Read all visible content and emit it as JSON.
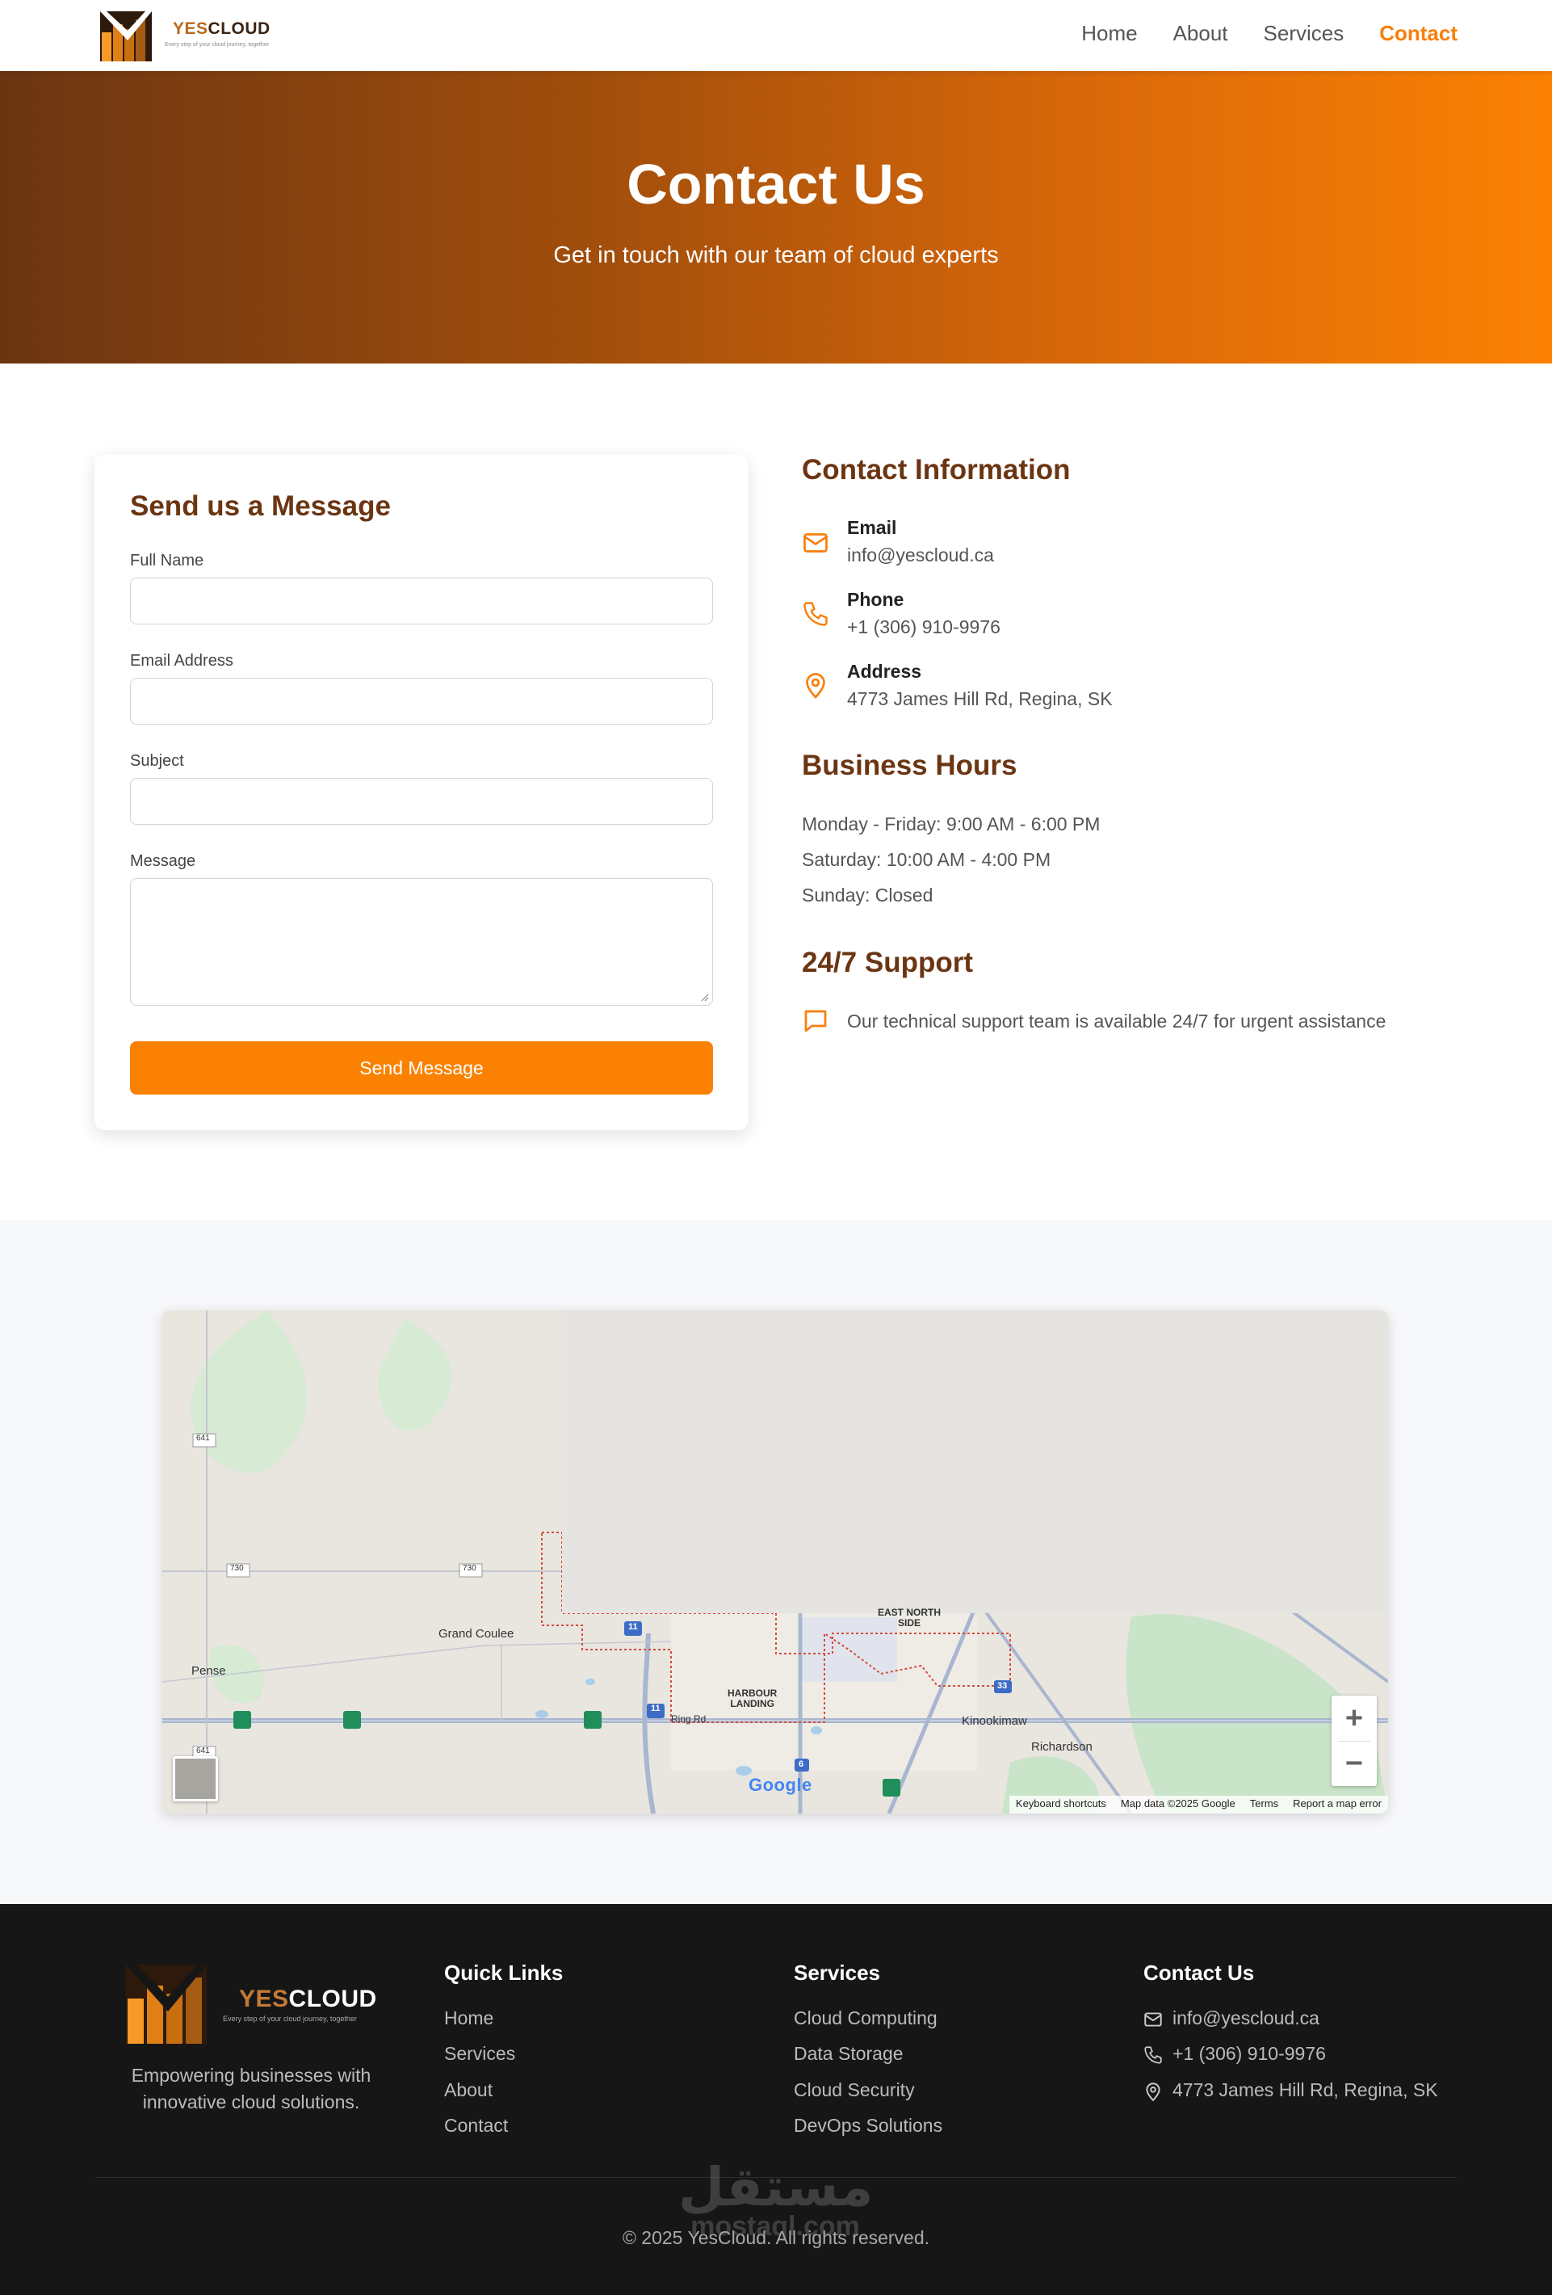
{
  "brand": {
    "name_part1": "YES",
    "name_part2": "CLOUD",
    "tagline": "Every step of your cloud journey, together"
  },
  "nav": {
    "links": [
      {
        "label": "Home",
        "active": false
      },
      {
        "label": "About",
        "active": false
      },
      {
        "label": "Services",
        "active": false
      },
      {
        "label": "Contact",
        "active": true
      }
    ]
  },
  "hero": {
    "title": "Contact Us",
    "subtitle": "Get in touch with our team of cloud experts"
  },
  "form": {
    "heading": "Send us a Message",
    "fields": [
      {
        "label": "Full Name",
        "value": ""
      },
      {
        "label": "Email Address",
        "value": ""
      },
      {
        "label": "Subject",
        "value": ""
      },
      {
        "label": "Message",
        "value": ""
      }
    ],
    "submit_label": "Send Message"
  },
  "contact_info": {
    "heading": "Contact Information",
    "items": [
      {
        "icon": "mail-icon",
        "title": "Email",
        "value": "info@yescloud.ca"
      },
      {
        "icon": "phone-icon",
        "title": "Phone",
        "value": "+1 (306) 910-9976"
      },
      {
        "icon": "map-pin-icon",
        "title": "Address",
        "value": "4773 James Hill Rd, Regina, SK"
      }
    ]
  },
  "hours": {
    "heading": "Business Hours",
    "lines": [
      "Monday - Friday: 9:00 AM - 6:00 PM",
      "Saturday: 10:00 AM - 4:00 PM",
      "Sunday: Closed"
    ]
  },
  "support": {
    "heading": "24/7 Support",
    "text": "Our technical support team is available 24/7 for urgent assistance"
  },
  "map": {
    "place_labels": [
      "Grand Coulee",
      "Pense",
      "HARBOUR\nLANDING",
      "EAST NORTH\nSIDE",
      "Kinookimaw",
      "Richardson",
      "Ring Rd"
    ],
    "route_shields": [
      "641",
      "730",
      "730",
      "11",
      "11",
      "6",
      "33",
      "641"
    ],
    "attribution": [
      "Keyboard shortcuts",
      "Map data ©2025 Google",
      "Terms",
      "Report a map error"
    ],
    "google_logo": "Google",
    "zoom_in": "+",
    "zoom_out": "−"
  },
  "footer": {
    "tagline": "Empowering businesses with innovative cloud solutions.",
    "quick_links": {
      "heading": "Quick Links",
      "links": [
        "Home",
        "Services",
        "About",
        "Contact"
      ]
    },
    "services": {
      "heading": "Services",
      "links": [
        "Cloud Computing",
        "Data Storage",
        "Cloud Security",
        "DevOps Solutions"
      ]
    },
    "contact": {
      "heading": "Contact Us",
      "items": [
        "info@yescloud.ca",
        "+1 (306) 910-9976",
        "4773 James Hill Rd, Regina, SK"
      ]
    },
    "copyright": "© 2025 YesCloud. All rights reserved.",
    "watermark_line1": "مستقل",
    "watermark_line2": "mostaql.com"
  },
  "colors": {
    "accent": "#fb8103",
    "brown": "#6b3512",
    "footer_bg": "#161616",
    "map_section_bg": "#f7f8fa"
  }
}
